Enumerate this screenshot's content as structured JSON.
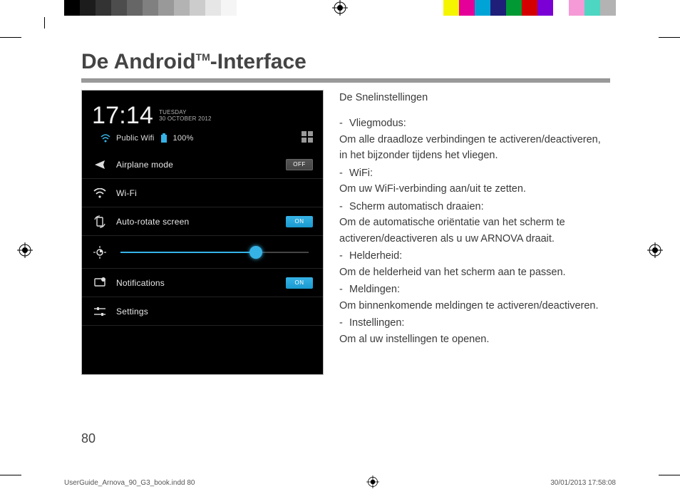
{
  "colorbar_left": [
    "#000000",
    "#1c1c1c",
    "#333333",
    "#4d4d4d",
    "#666666",
    "#808080",
    "#999999",
    "#b3b3b3",
    "#cccccc",
    "#e6e6e6",
    "#f5f5f5",
    "#ffffff"
  ],
  "colorbar_right": [
    "#ffffff",
    "#f5f500",
    "#e6009a",
    "#00a3d6",
    "#1f1f7a",
    "#009933",
    "#d40000",
    "#7a00d6",
    "#ffffff",
    "#f59ad6",
    "#4dd6c2",
    "#b3b3b3"
  ],
  "title_pre": "De Android",
  "title_tm": "TM",
  "title_post": "-Interface",
  "phone": {
    "clock": "17:14",
    "day": "TUESDAY",
    "date": "30 OCTOBER 2012",
    "wifi_ssid": "Public Wifi",
    "battery": "100%",
    "rows": {
      "airplane": {
        "label": "Airplane mode",
        "toggle": "OFF"
      },
      "wifi": {
        "label": "Wi-Fi"
      },
      "rotate": {
        "label": "Auto-rotate screen",
        "toggle": "ON"
      },
      "brightness": {
        "label": "",
        "slider_pct": 72
      },
      "notif": {
        "label": "Notifications",
        "toggle": "ON"
      },
      "settings": {
        "label": "Settings"
      }
    }
  },
  "text": {
    "heading": "De Snelinstellingen",
    "i1t": "Vliegmodus:",
    "i1b": "Om alle draadloze verbindingen te activeren/deactiveren, in het bijzonder tijdens het vliegen.",
    "i2t": "WiFi:",
    "i2b": "Om uw WiFi-verbinding aan/uit te zetten.",
    "i3t": "Scherm automatisch draaien:",
    "i3b": "Om de automatische oriëntatie van het scherm te activeren/deactiveren als u uw ARNOVA draait.",
    "i4t": "Helderheid:",
    "i4b": "Om de helderheid van het scherm aan te passen.",
    "i5t": "Meldingen:",
    "i5b": "Om binnenkomende meldingen te activeren/deactiveren.",
    "i6t": "Instellingen:",
    "i6b": "Om al uw instellingen te openen."
  },
  "page_number": "80",
  "footer_file": "UserGuide_Arnova_90_G3_book.indd   80",
  "footer_date": "30/01/2013   17:58:08"
}
